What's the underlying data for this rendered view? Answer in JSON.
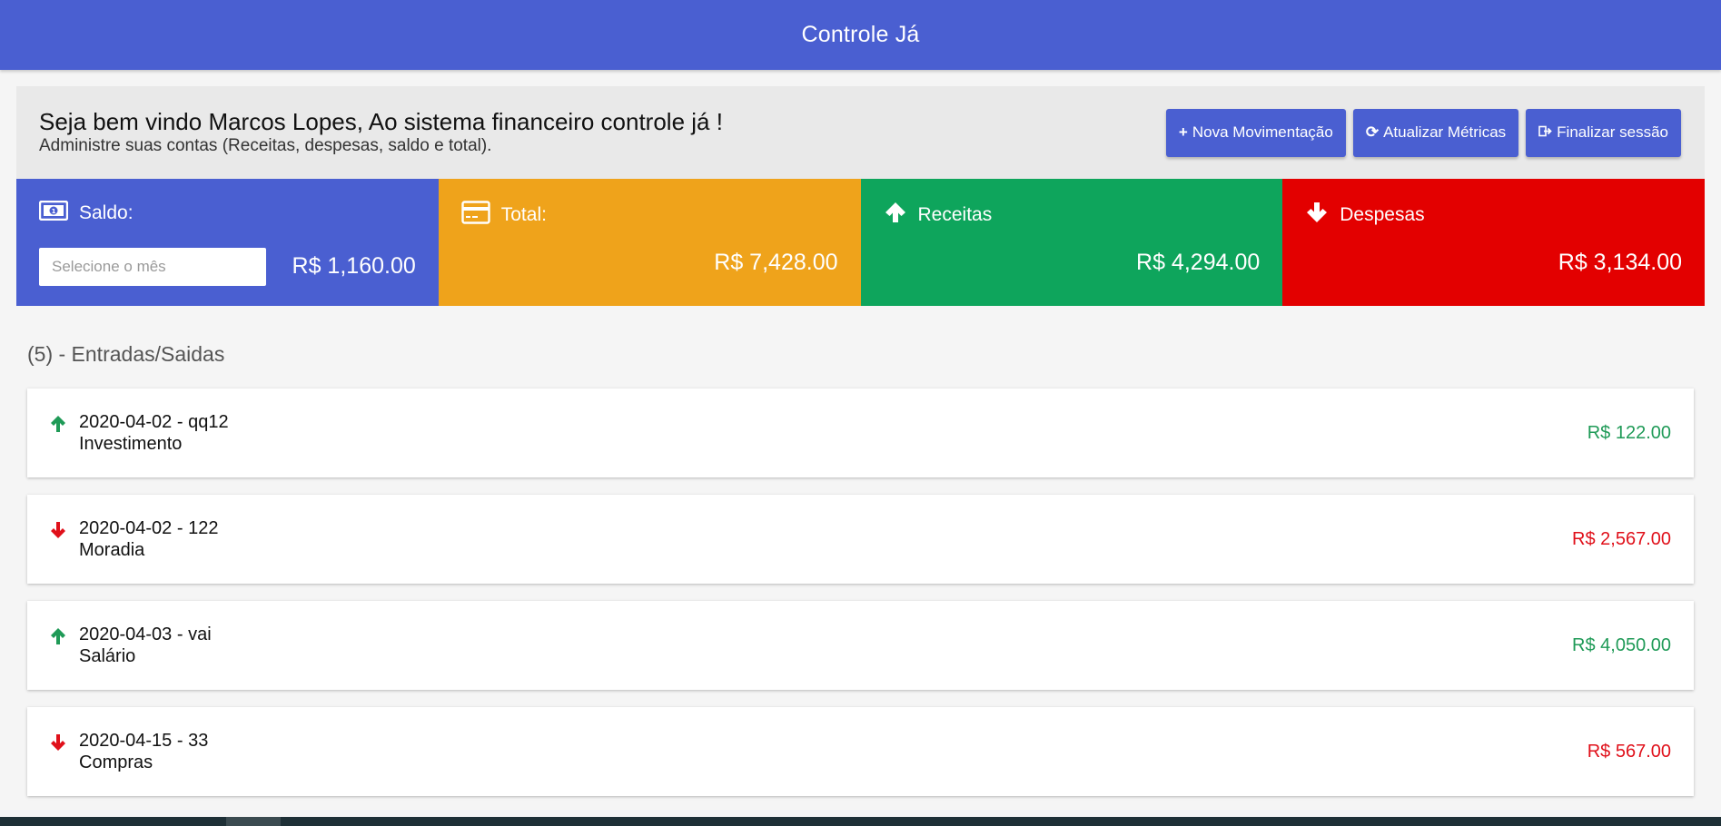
{
  "app": {
    "title": "Controle Já"
  },
  "welcome": {
    "headline": "Seja bem vindo Marcos Lopes, Ao sistema financeiro controle já !",
    "subtitle": "Administre suas contas (Receitas, despesas, saldo e total)."
  },
  "actions": {
    "new_label": "Nova Movimentação",
    "refresh_label": "Atualizar Métricas",
    "logout_label": "Finalizar sessão"
  },
  "metrics": {
    "saldo": {
      "label": "Saldo:",
      "value": "R$ 1,160.00",
      "month_placeholder": "Selecione o mês",
      "color": "#4a5fd1"
    },
    "total": {
      "label": "Total:",
      "value": "R$ 7,428.00",
      "color": "#efa31b"
    },
    "receitas": {
      "label": "Receitas",
      "value": "R$ 4,294.00",
      "color": "#0ea55c"
    },
    "despesas": {
      "label": "Despesas",
      "value": "R$ 3,134.00",
      "color": "#e30000"
    }
  },
  "transactions": {
    "title": "(5) - Entradas/Saidas",
    "items": [
      {
        "type": "in",
        "line1": "2020-04-02 - qq12",
        "line2": "Investimento",
        "amount": "R$ 122.00"
      },
      {
        "type": "out",
        "line1": "2020-04-02 - 122",
        "line2": "Moradia",
        "amount": "R$ 2,567.00"
      },
      {
        "type": "in",
        "line1": "2020-04-03 - vai",
        "line2": "Salário",
        "amount": "R$ 4,050.00"
      },
      {
        "type": "out",
        "line1": "2020-04-15 - 33",
        "line2": "Compras",
        "amount": "R$ 567.00"
      }
    ]
  },
  "colors": {
    "income": "#1f9a57",
    "expense": "#e0101a",
    "primary": "#4a5fd1"
  }
}
